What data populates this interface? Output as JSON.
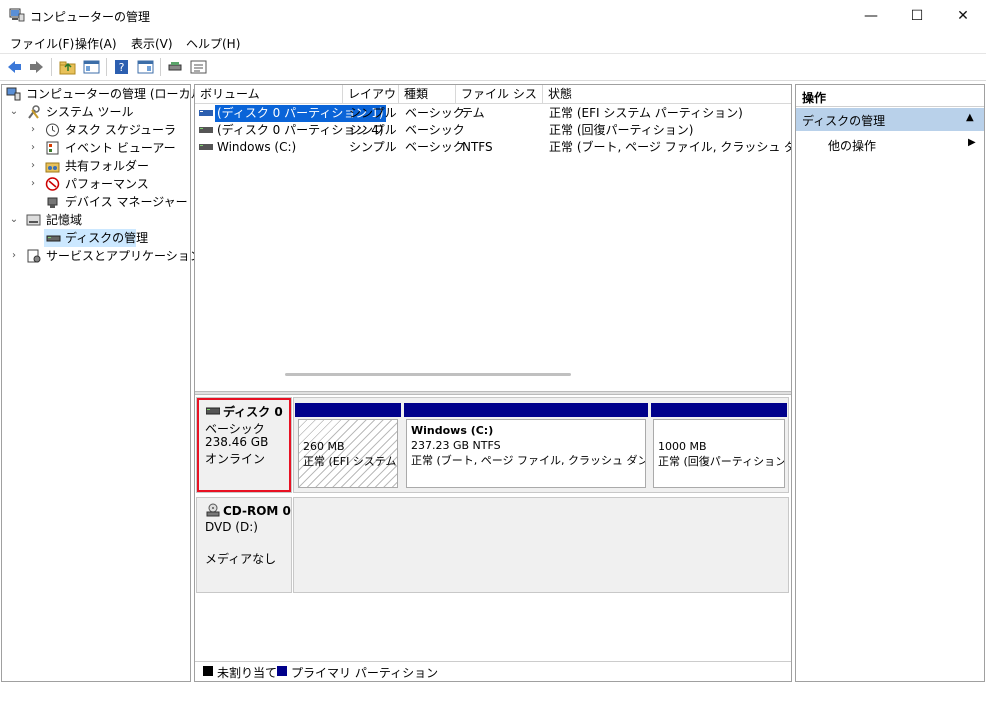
{
  "window": {
    "title": "コンピューターの管理",
    "minimize": "—",
    "maximize": "☐",
    "close": "✕"
  },
  "menu": [
    "ファイル(F)",
    "操作(A)",
    "表示(V)",
    "ヘルプ(H)"
  ],
  "tree": {
    "root": "コンピューターの管理 (ローカル)",
    "system_tools": "システム ツール",
    "task_scheduler": "タスク スケジューラ",
    "event_viewer": "イベント ビューアー",
    "shared_folders": "共有フォルダー",
    "performance": "パフォーマンス",
    "device_manager": "デバイス マネージャー",
    "storage": "記憶域",
    "disk_management": "ディスクの管理",
    "services_apps": "サービスとアプリケーション"
  },
  "volume_table": {
    "headers": [
      "ボリューム",
      "レイアウト",
      "種類",
      "ファイル システム",
      "状態"
    ],
    "rows": [
      [
        "(ディスク 0 パーティション 1)",
        "シンプル",
        "ベーシック",
        "",
        "正常 (EFI システム パーティション)"
      ],
      [
        "(ディスク 0 パーティション 4)",
        "シンプル",
        "ベーシック",
        "",
        "正常 (回復パーティション)"
      ],
      [
        "Windows (C:)",
        "シンプル",
        "ベーシック",
        "NTFS",
        "正常 (ブート, ページ ファイル, クラッシュ ダンプ, ベーシ"
      ]
    ]
  },
  "disks": {
    "disk0": {
      "name": "ディスク 0",
      "type": "ベーシック",
      "size": "238.46 GB",
      "status": "オンライン",
      "partitions": [
        {
          "size": "260 MB",
          "status": "正常 (EFI システム パ"
        },
        {
          "name": "Windows  (C:)",
          "size": "237.23 GB NTFS",
          "status": "正常 (ブート, ページ ファイル, クラッシュ ダンプ, ベー"
        },
        {
          "size": "1000 MB",
          "status": "正常 (回復パーティション)"
        }
      ]
    },
    "cdrom0": {
      "name": "CD-ROM 0",
      "type": "DVD (D:)",
      "status": "メディアなし"
    }
  },
  "legend": [
    "未割り当て",
    "プライマリ パーティション"
  ],
  "actions": {
    "header": "操作",
    "section": "ディスクの管理",
    "other": "他の操作"
  },
  "colors": {
    "primary_partition": "#00008b",
    "unallocated": "#000000",
    "selection": "#cce8ff",
    "highlight_border": "#e81123",
    "action_header_bg": "#b9d1ea"
  }
}
